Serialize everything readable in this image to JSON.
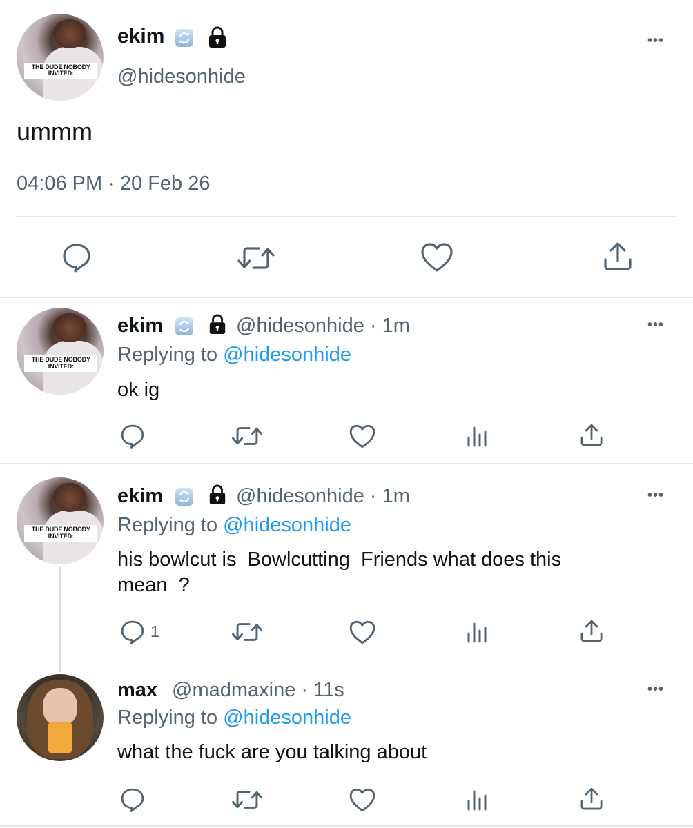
{
  "main_tweet": {
    "avatar_caption": "THE DUDE NOBODY INVITED:",
    "display_name": "ekim",
    "handle": "@hidesonhide",
    "more": "•••",
    "text": "ummm",
    "timestamp": "04:06 PM · 20 Feb 26",
    "icons": [
      "reply-icon",
      "retweet-icon",
      "like-icon",
      "share-icon"
    ]
  },
  "replies": [
    {
      "avatar_caption": "THE DUDE NOBODY INVITED:",
      "display_name": "ekim",
      "handle_time": "@hidesonhide · 1m",
      "replying_prefix": "Replying to",
      "replying_to": "@hidesonhide",
      "text_lines": [
        "ok ig"
      ],
      "reply_count": "",
      "more": "•••"
    },
    {
      "avatar_caption": "THE DUDE NOBODY INVITED:",
      "display_name": "ekim",
      "handle_time": "@hidesonhide · 1m",
      "replying_prefix": "Replying to",
      "replying_to": "@hidesonhide",
      "text_lines": [
        "his bowlcut is  Bowlcutting  Friends what does this",
        "mean  ?"
      ],
      "reply_count": "1",
      "more": "•••"
    },
    {
      "display_name": "max",
      "handle_time": "@madmaxine · 11s",
      "replying_prefix": "Replying to",
      "replying_to": "@hidesonhide",
      "text_lines": [
        "what the fuck are you talking about"
      ],
      "reply_count": "",
      "more": "•••"
    }
  ],
  "colors": {
    "text": "#0f1419",
    "muted": "#536471",
    "link": "#1d9bf0",
    "divider": "#e6e6e6"
  }
}
